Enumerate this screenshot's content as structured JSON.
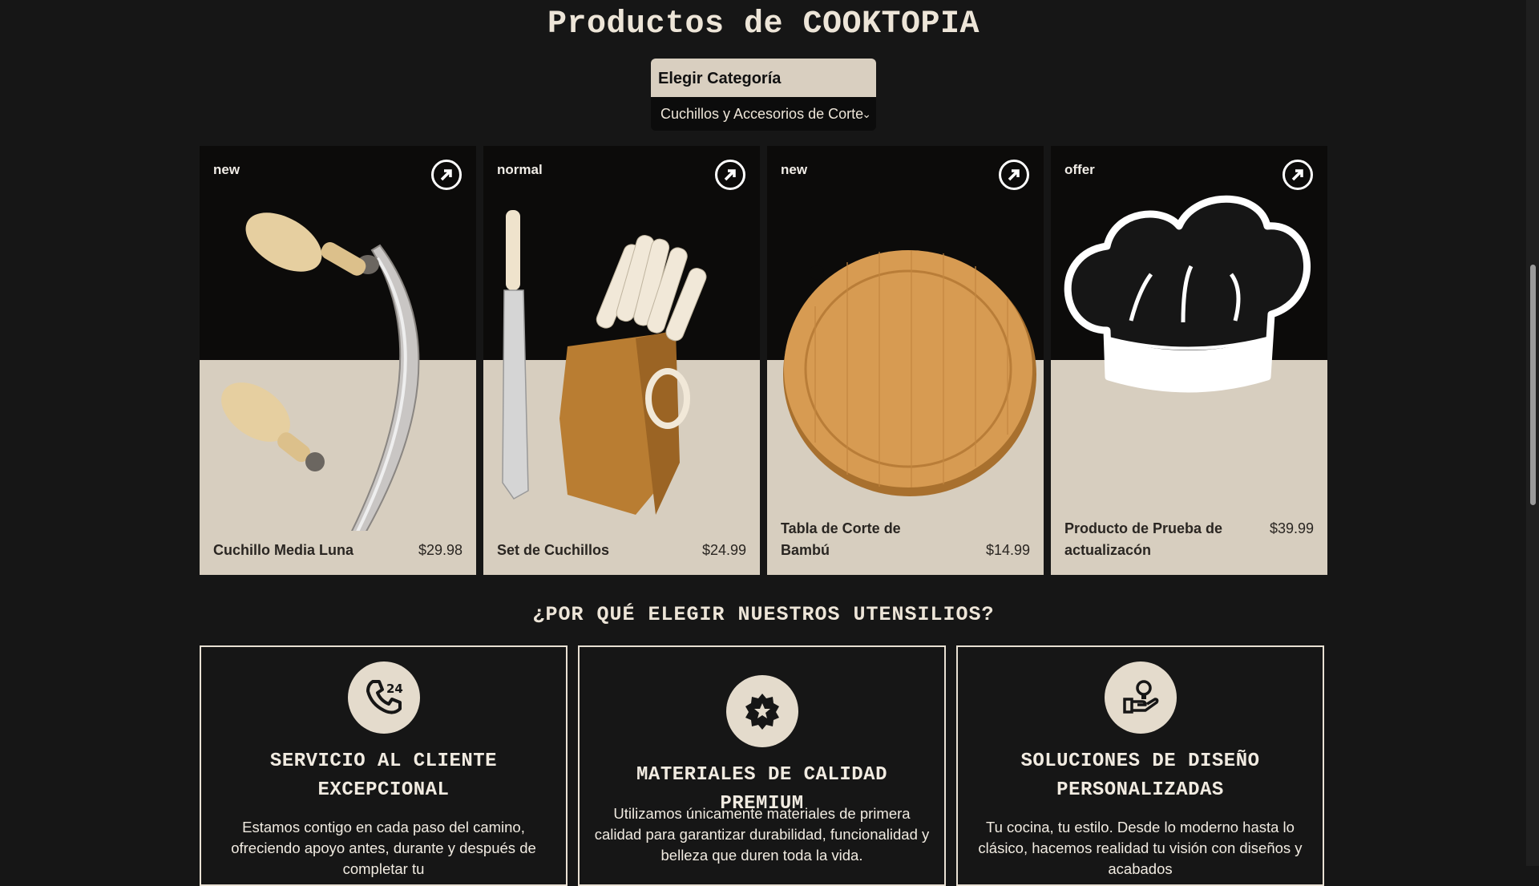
{
  "header": {
    "title": "Productos de COOKTOPIA"
  },
  "category": {
    "label": "Elegir Categoría",
    "selected": "Cuchillos y Accesorios de Corte"
  },
  "products": [
    {
      "tag": "new",
      "name": "Cuchillo Media Luna",
      "price": "$29.98",
      "image": "mezzaluna-knife-image"
    },
    {
      "tag": "normal",
      "name": "Set de Cuchillos",
      "price": "$24.99",
      "image": "knife-block-set-image"
    },
    {
      "tag": "new",
      "name": "Tabla de Corte de Bambú",
      "price": "$14.99",
      "image": "bamboo-cutting-board-image"
    },
    {
      "tag": "offer",
      "name": "Producto de Prueba de actualizacón",
      "price": "$39.99",
      "image": "chef-hat-shop-logo"
    }
  ],
  "why": {
    "title": "¿POR QUÉ ELEGIR NUESTROS UTENSILIOS?",
    "features": [
      {
        "icon": "phone-24-icon",
        "title": "SERVICIO AL CLIENTE EXCEPCIONAL",
        "text": "Estamos contigo en cada paso del camino, ofreciendo apoyo antes, durante y después de completar tu"
      },
      {
        "icon": "star-badge-icon",
        "title": "MATERIALES DE CALIDAD PREMIUM",
        "text": "Utilizamos únicamente materiales de primera calidad para garantizar durabilidad, funcionalidad y belleza que duren toda la vida."
      },
      {
        "icon": "idea-hand-icon",
        "title": "SOLUCIONES DE DISEÑO PERSONALIZADAS",
        "text": "Tu cocina, tu estilo. Desde lo moderno hasta lo clásico, hacemos realidad tu visión con diseños y acabados"
      }
    ]
  },
  "colors": {
    "background": "#161616",
    "card_light": "#d7cebf",
    "accent": "#e4dbcc",
    "title": "#ede5d8"
  }
}
